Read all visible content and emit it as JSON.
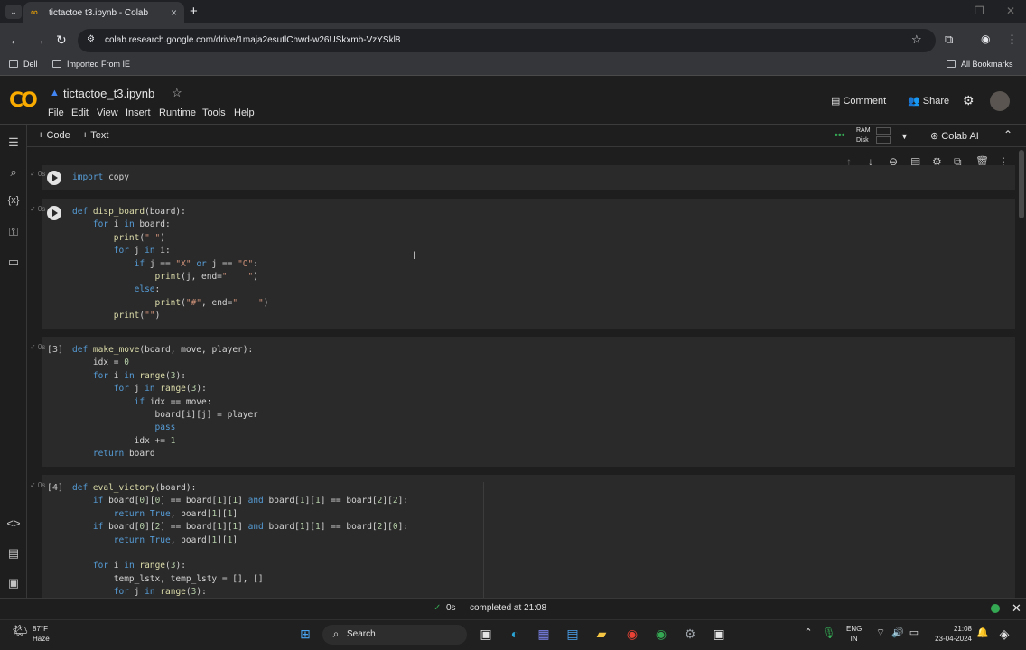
{
  "browser": {
    "tab_title": "tictactoe t3.ipynb - Colab",
    "new_tab": "+",
    "tab_close": "×",
    "url": "colab.research.google.com/drive/1maja2esutlChwd-w26USkxmb-VzYSkl8",
    "bookmarks": [
      "Dell",
      "Imported From IE"
    ],
    "all_bookmarks": "All Bookmarks"
  },
  "colab": {
    "notebook_name": "tictactoe_t3.ipynb",
    "menu": [
      "File",
      "Edit",
      "View",
      "Insert",
      "Runtime",
      "Tools",
      "Help"
    ],
    "comment": "Comment",
    "share": "Share",
    "add_code": "+ Code",
    "add_text": "+ Text",
    "ram": "RAM",
    "disk": "Disk",
    "colab_ai": "Colab AI"
  },
  "cells": [
    {
      "exec": "",
      "lines": [
        "import copy"
      ]
    },
    {
      "exec": "",
      "lines": [
        "def disp_board(board):",
        "    for i in board:",
        "        print(\" \")",
        "        for j in i:",
        "            if j == \"X\" or j == \"O\":",
        "                print(j, end=\"    \")",
        "            else:",
        "                print(\"#\", end=\"    \")",
        "        print(\"\")"
      ]
    },
    {
      "exec": "[3]",
      "lines": [
        "def make_move(board, move, player):",
        "    idx = 0",
        "    for i in range(3):",
        "        for j in range(3):",
        "            if idx == move:",
        "                board[i][j] = player",
        "                pass",
        "            idx += 1",
        "    return board"
      ]
    },
    {
      "exec": "[4]",
      "lines": [
        "def eval_victory(board):",
        "    if board[0][0] == board[1][1] and board[1][1] == board[2][2]:",
        "        return True, board[1][1]",
        "    if board[0][2] == board[1][1] and board[1][1] == board[2][0]:",
        "        return True, board[1][1]",
        "",
        "    for i in range(3):",
        "        temp_lstx, temp_lsty = [], []",
        "        for j in range(3):"
      ]
    }
  ],
  "gutter_marks": [
    "✓ 0s",
    "✓ 0s",
    "✓ 0s",
    "✓ 0s"
  ],
  "status": {
    "check": "✓",
    "duration": "0s",
    "message": "completed at 21:08"
  },
  "taskbar": {
    "weather_temp": "87°F",
    "weather_desc": "Haze",
    "search": "Search",
    "lang1": "ENG",
    "lang2": "IN",
    "time": "21:08",
    "date": "23-04-2024"
  }
}
